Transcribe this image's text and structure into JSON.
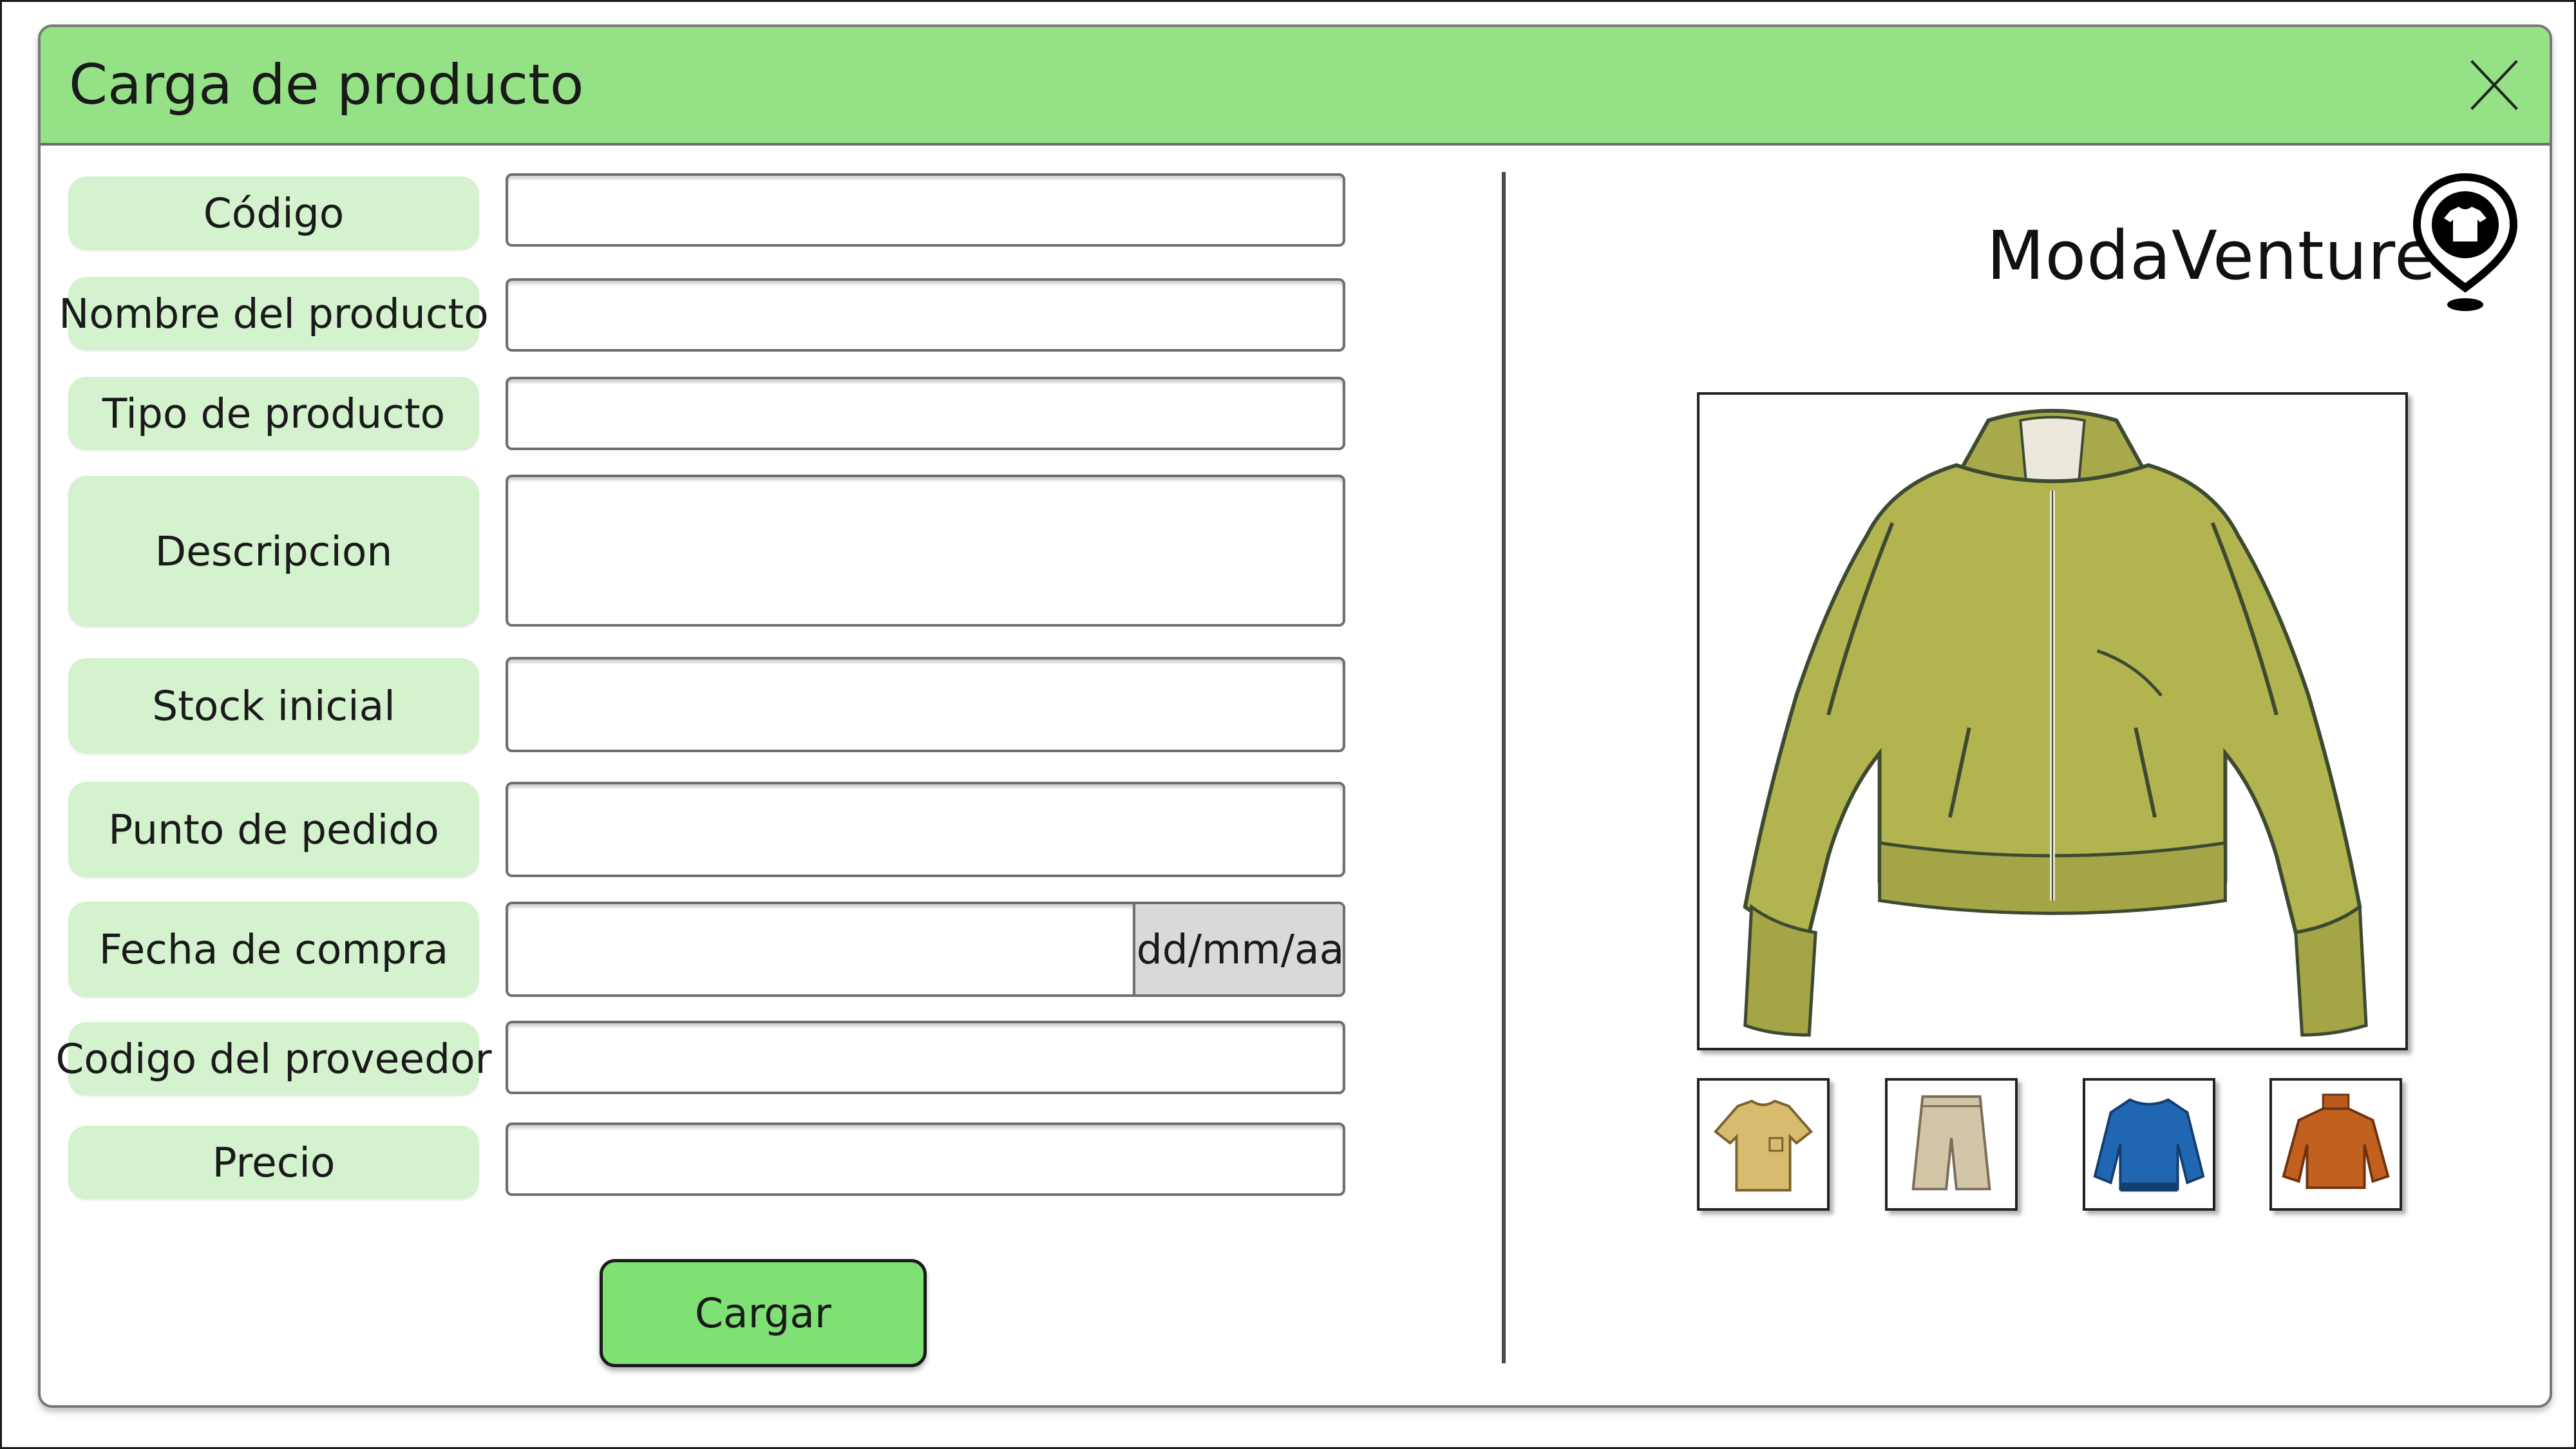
{
  "window": {
    "title": "Carga de producto"
  },
  "form": {
    "fields": [
      {
        "label": "Código",
        "value": "",
        "placeholder": ""
      },
      {
        "label": "Nombre del producto",
        "value": "",
        "placeholder": ""
      },
      {
        "label": "Tipo de producto",
        "value": "",
        "placeholder": ""
      },
      {
        "label": "Descripcion",
        "value": "",
        "placeholder": ""
      },
      {
        "label": "Stock inicial",
        "value": "",
        "placeholder": ""
      },
      {
        "label": "Punto de pedido",
        "value": "",
        "placeholder": ""
      },
      {
        "label": "Fecha de compra",
        "value": "",
        "placeholder": "",
        "suffix": "dd/mm/aa"
      },
      {
        "label": "Codigo del proveedor",
        "value": "",
        "placeholder": ""
      },
      {
        "label": "Precio",
        "value": "",
        "placeholder": ""
      }
    ],
    "submit_label": "Cargar"
  },
  "brand": {
    "name": "ModaVenture",
    "logo_icon": "map-pin-tshirt-icon"
  },
  "gallery": {
    "main_image": "bomber-jacket-image",
    "thumbnails": [
      {
        "icon": "tshirt-thumbnail"
      },
      {
        "icon": "shorts-thumbnail"
      },
      {
        "icon": "sweatshirt-thumbnail"
      },
      {
        "icon": "turtleneck-sweater-thumbnail"
      }
    ]
  },
  "colors": {
    "title_bar": "#94e285",
    "label_bg": "#d3f2cd",
    "submit_bg": "#7fe073",
    "date_suffix_bg": "#d9d9d9",
    "jacket": "#b2b450"
  }
}
